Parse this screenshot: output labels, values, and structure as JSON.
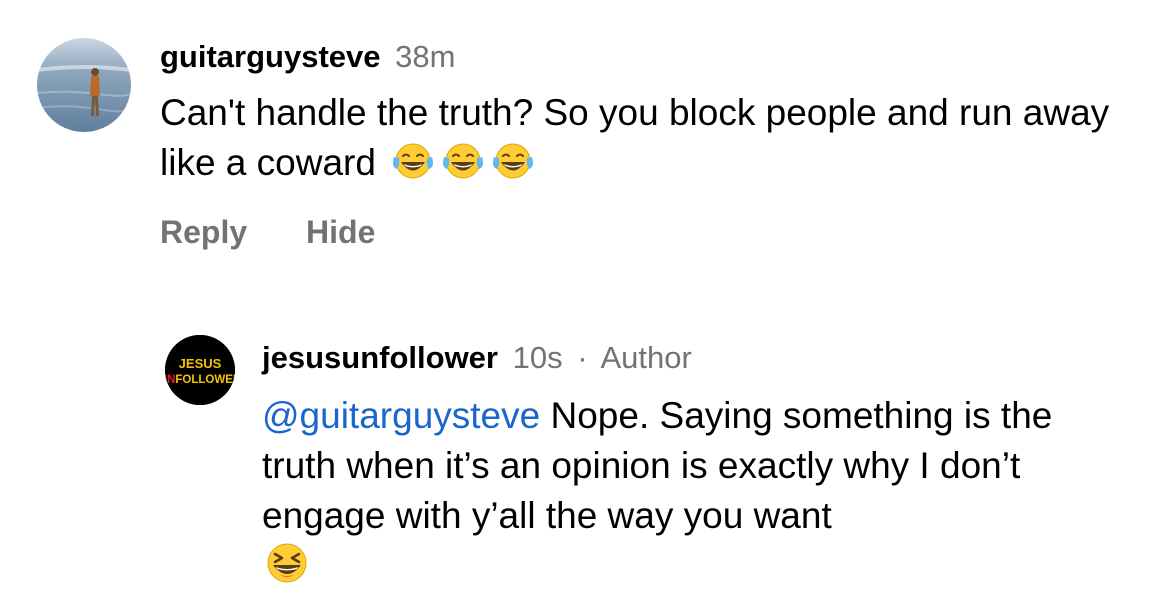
{
  "comments": [
    {
      "username": "guitarguysteve",
      "time": "38m",
      "text": "Can't handle the truth? So you block people and run away like a coward",
      "emojis": [
        "face-with-tears-of-joy-icon",
        "face-with-tears-of-joy-icon",
        "face-with-tears-of-joy-icon"
      ],
      "actions": {
        "reply_label": "Reply",
        "hide_label": "Hide"
      }
    }
  ],
  "reply": {
    "username": "jesusunfollower",
    "time": "10s",
    "separator": "·",
    "author_label": "Author",
    "mention": "@guitarguysteve",
    "text": " Nope. Saying something is the truth when it’s an opinion is exactly why I don’t engage with y’all the way you want",
    "emoji": "grinning-squinting-face-icon",
    "avatar_logo": {
      "line1": "JESUS",
      "line2_red": "UN",
      "line2_rest": "FOLLOWER"
    }
  },
  "colors": {
    "meta_gray": "#737373",
    "mention_blue": "#1a66cc",
    "logo_yellow": "#f5c400",
    "logo_red": "#e0201b"
  }
}
